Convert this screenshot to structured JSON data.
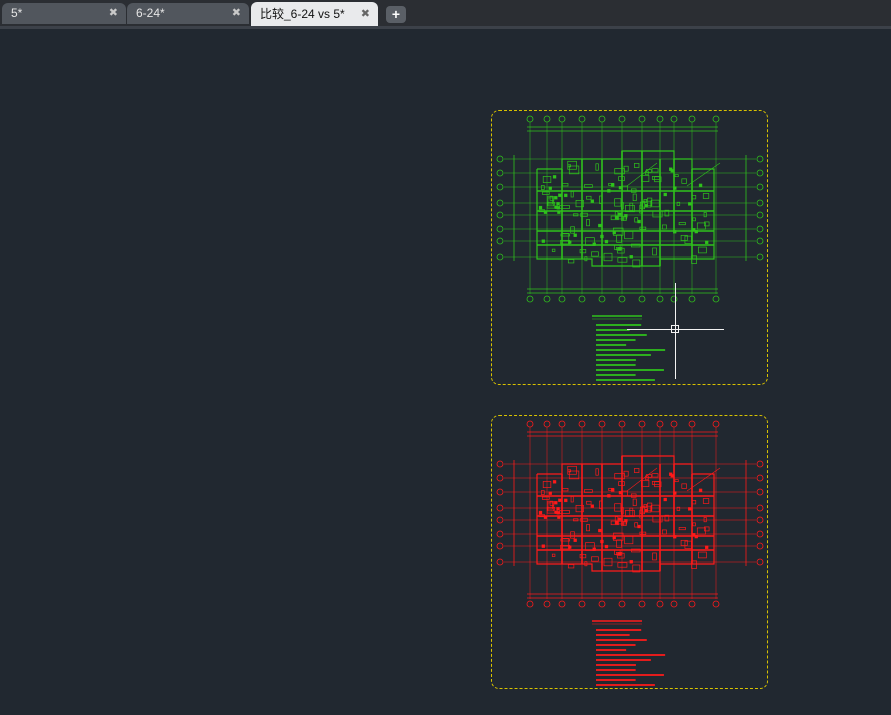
{
  "tabs": [
    {
      "label": "5*",
      "active": false
    },
    {
      "label": "6-24*",
      "active": false
    },
    {
      "label": "比较_6-24 vs 5*",
      "active": true
    }
  ],
  "tab_close_glyph": "✖",
  "tab_add_glyph": "+",
  "colors": {
    "background": "#212830",
    "sheet_border": "#d8c200",
    "drawing_a": "#2fc21c",
    "drawing_b": "#ff1a1a",
    "crosshair": "#f2f2f2"
  },
  "icons": {
    "close": "close-icon",
    "add": "plus-icon",
    "cursor": "crosshair-cursor-icon"
  }
}
